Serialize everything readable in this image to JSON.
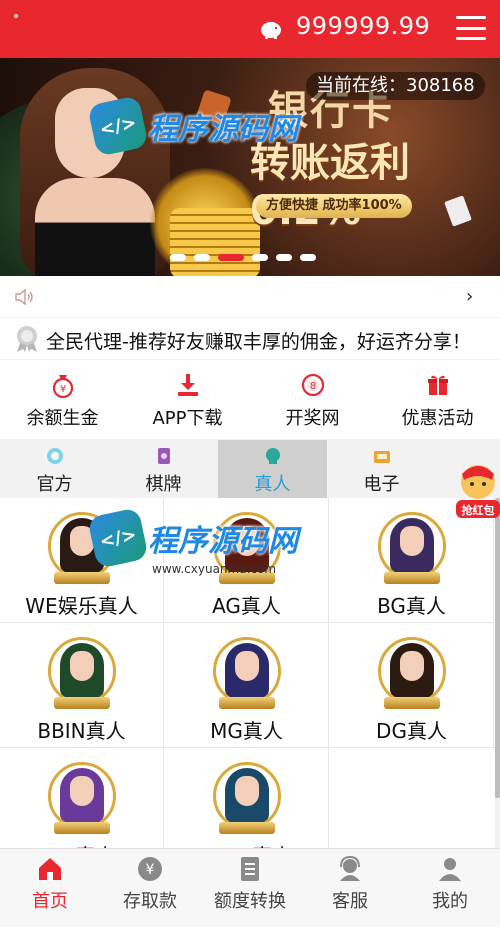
{
  "header": {
    "balance": "999999.99",
    "wallet_icon": "piggy-bank-icon",
    "menu_icon": "hamburger-menu-icon"
  },
  "banner": {
    "online_label": "当前在线：308168",
    "headline_line1": "银行卡",
    "headline_line2": "转账返利0.2%",
    "tagline": "方便快捷 成功率100%",
    "slide_count": 6,
    "active_slide": 2
  },
  "watermark": {
    "text": "程序源码网",
    "badge": "</>",
    "sub": "www.cxyuanma.com"
  },
  "speaker_bar": {
    "icon": "speaker-icon",
    "chevron": "›"
  },
  "notice": {
    "text": "全民代理-推荐好友赚取丰厚的佣金，好运齐分享！"
  },
  "quick_actions": [
    {
      "label": "余额生金",
      "icon": "money-bag-icon"
    },
    {
      "label": "APP下载",
      "icon": "download-icon"
    },
    {
      "label": "开奖网",
      "icon": "lottery-ball-icon"
    },
    {
      "label": "优惠活动",
      "icon": "gift-icon"
    }
  ],
  "tabs": [
    {
      "label": "官方",
      "icon": "official-icon"
    },
    {
      "label": "棋牌",
      "icon": "cards-icon"
    },
    {
      "label": "真人",
      "icon": "live-icon"
    },
    {
      "label": "电子",
      "icon": "slot-icon"
    }
  ],
  "active_tab": 2,
  "float_badge": "抢红包",
  "games": [
    {
      "name": "WE娱乐真人",
      "hair": "#2a1a14"
    },
    {
      "name": "AG真人",
      "hair": "#5a1a10"
    },
    {
      "name": "BG真人",
      "hair": "#3a2a60"
    },
    {
      "name": "BBIN真人",
      "hair": "#1f4a2a"
    },
    {
      "name": "MG真人",
      "hair": "#2a2a6a"
    },
    {
      "name": "DG真人",
      "hair": "#2a1a10"
    },
    {
      "name": "AB真人",
      "hair": "#6a3a9a"
    },
    {
      "name": "EBET真人",
      "hair": "#1a4a6a"
    }
  ],
  "bottom_nav": [
    {
      "label": "首页",
      "icon": "home-icon"
    },
    {
      "label": "存取款",
      "icon": "yen-coin-icon"
    },
    {
      "label": "额度转换",
      "icon": "transfer-icon"
    },
    {
      "label": "客服",
      "icon": "customer-service-icon"
    },
    {
      "label": "我的",
      "icon": "user-icon"
    }
  ],
  "active_nav": 0,
  "colors": {
    "brand_red": "#e8282e",
    "tab_active_text": "#2b9bd6",
    "gold": "#d9a93b"
  }
}
